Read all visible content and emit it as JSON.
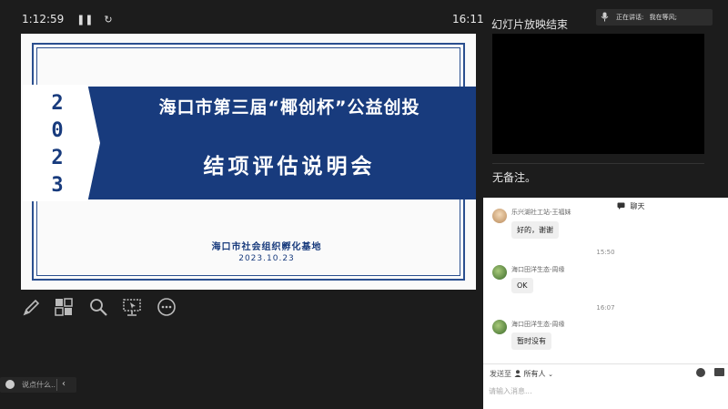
{
  "presenter": {
    "elapsed": "1:12:59",
    "clock": "16:11",
    "pause_icon": "pause-icon",
    "reset_icon": "restart-icon"
  },
  "slide": {
    "year": [
      "2",
      "0",
      "2",
      "3"
    ],
    "title_line1": "海口市第三届“椰创杯”公益创投",
    "title_line2": "结项评估说明会",
    "organizer": "海口市社会组织孵化基地",
    "date": "2023.10.23"
  },
  "tools": [
    "pen-icon",
    "slide-sorter-icon",
    "zoom-icon",
    "pointer-screen-icon",
    "more-icon"
  ],
  "bottom_bar": {
    "placeholder": "说点什么..."
  },
  "right_panel": {
    "next_slide_title": "幻灯片放映结束",
    "speaker_label": "正在讲话:",
    "speaker_name": "我在等风;",
    "notes": "无备注。"
  },
  "chat": {
    "header": "聊天",
    "messages": [
      {
        "sender": "乐兴湖社工站-王福妹",
        "text": "好的，谢谢"
      },
      {
        "time": "15:50"
      },
      {
        "sender": "海口田洋生态-周缘",
        "text": "OK"
      },
      {
        "time": "16:07"
      },
      {
        "sender": "海口田洋生态-周缘",
        "text": "暂时没有"
      }
    ],
    "send_to_label": "发送至",
    "audience": "所有人",
    "input_placeholder": "请输入消息..."
  }
}
